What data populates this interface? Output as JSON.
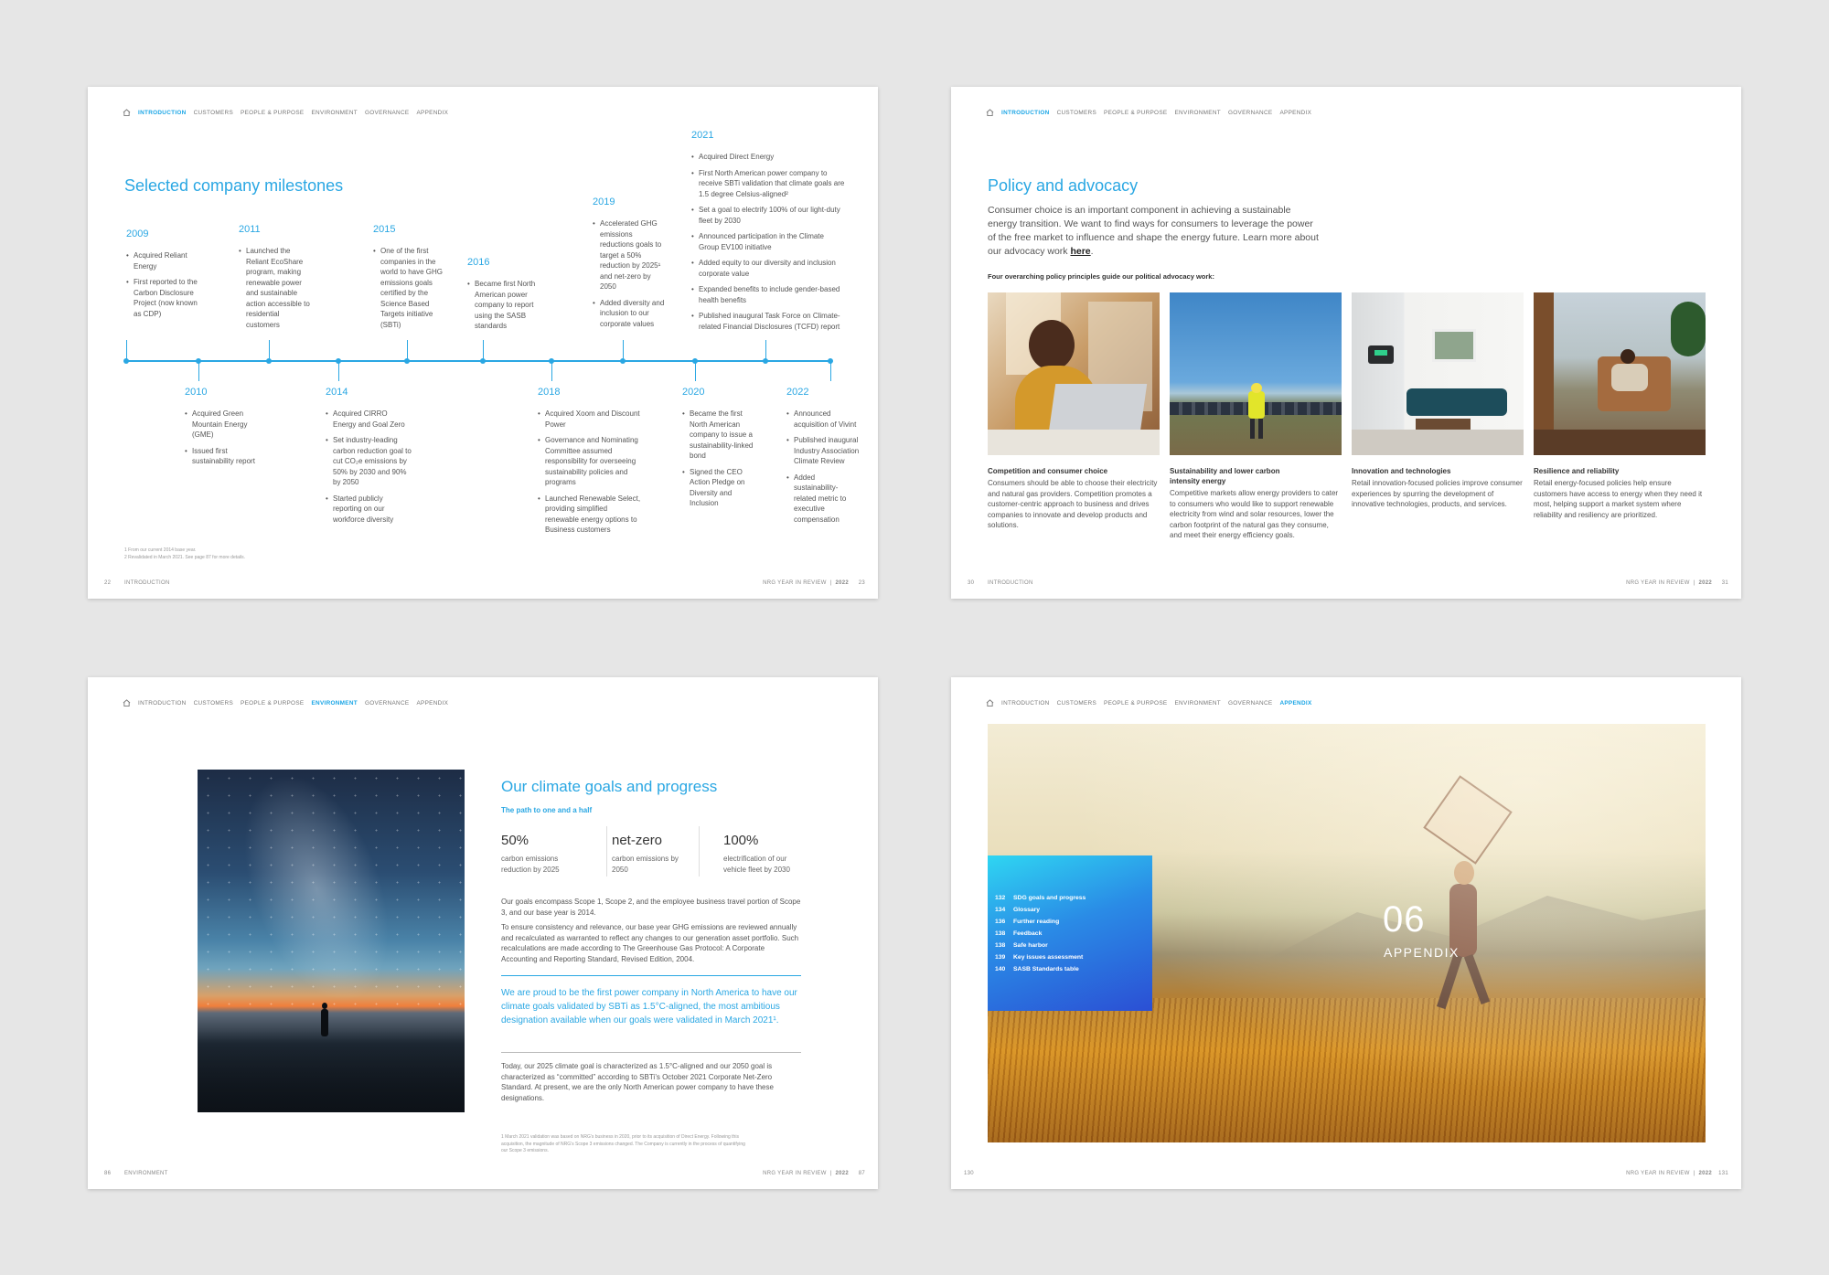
{
  "nav_items": [
    "INTRODUCTION",
    "CUSTOMERS",
    "PEOPLE & PURPOSE",
    "ENVIRONMENT",
    "GOVERNANCE",
    "APPENDIX"
  ],
  "brand_footer": "NRG YEAR IN REVIEW",
  "brand_year": "2022",
  "colors": {
    "accent": "#2aa7e3",
    "background": "#e6e6e6",
    "page": "#ffffff"
  },
  "spread1": {
    "active_nav": "INTRODUCTION",
    "title": "Selected company milestones",
    "milestones_top": [
      {
        "year": "2009",
        "items": [
          "Acquired Reliant Energy",
          "First reported to the Carbon Disclosure Project (now known as CDP)"
        ]
      },
      {
        "year": "2011",
        "items": [
          "Launched the Reliant EcoShare program, making renewable power and sustainable action accessible to residential customers"
        ]
      },
      {
        "year": "2015",
        "items": [
          "One of the first companies in the world to have GHG emissions goals certified by the Science Based Targets initiative (SBTi)"
        ]
      },
      {
        "year": "2016",
        "items": [
          "Became first North American power company to report using the SASB standards"
        ]
      },
      {
        "year": "2019",
        "items": [
          "Accelerated GHG emissions reductions goals to target a 50% reduction by 2025¹ and net-zero by 2050",
          "Added diversity and inclusion to our corporate values"
        ]
      },
      {
        "year": "2021",
        "items": [
          "Acquired Direct Energy",
          "First North American power company to receive SBTi validation that climate goals are 1.5 degree Celsius-aligned²",
          "Set a goal to electrify 100% of our light-duty fleet by 2030",
          "Announced participation in the Climate Group EV100 initiative",
          "Added equity to our diversity and inclusion corporate value",
          "Expanded benefits to include gender-based health benefits",
          "Published inaugural Task Force on Climate-related Financial Disclosures (TCFD) report"
        ]
      }
    ],
    "milestones_bottom": [
      {
        "year": "2010",
        "items": [
          "Acquired Green Mountain Energy (GME)",
          "Issued first sustainability report"
        ]
      },
      {
        "year": "2014",
        "items": [
          "Acquired CIRRO Energy and Goal Zero",
          "Set industry-leading carbon reduction goal to cut CO₂e emissions by 50% by 2030 and 90% by 2050",
          "Started publicly reporting on our workforce diversity"
        ]
      },
      {
        "year": "2018",
        "items": [
          "Acquired Xoom and Discount Power",
          "Governance and Nominating Committee assumed responsibility for overseeing sustainability policies and programs",
          "Launched Renewable Select, providing simplified renewable energy options to Business customers"
        ]
      },
      {
        "year": "2020",
        "items": [
          "Became the first North American company to issue a sustainability-linked bond",
          "Signed the CEO Action Pledge on Diversity and Inclusion"
        ]
      },
      {
        "year": "2022",
        "items": [
          "Announced acquisition of Vivint",
          "Published inaugural Industry Association Climate Review",
          "Added sustainability-related metric to executive compensation"
        ]
      }
    ],
    "footnotes": [
      "1   From our current 2014 base year.",
      "2   Revalidated in March 2021. See page 87 for more details."
    ],
    "page_left": "22",
    "section_label": "INTRODUCTION",
    "page_right": "23"
  },
  "spread2": {
    "active_nav": "INTRODUCTION",
    "title": "Policy and advocacy",
    "intro_text": "Consumer choice is an important component in achieving a sustainable energy transition. We want to find ways for consumers to leverage the power of the free market to influence and shape the energy future. Learn more about our advocacy work",
    "intro_link": "here",
    "subhead": "Four overarching policy principles guide our political advocacy work:",
    "cards": [
      {
        "title": "Competition and consumer choice",
        "body": "Consumers should be able to choose their electricity and natural gas providers. Competition promotes a customer-centric approach to business and drives companies to innovate and develop products and solutions."
      },
      {
        "title": "Sustainability and lower carbon intensity energy",
        "body": "Competitive markets allow energy providers to cater to consumers who would like to support renewable electricity from wind and solar resources, lower the carbon footprint of the natural gas they consume, and meet their energy efficiency goals."
      },
      {
        "title": "Innovation and technologies",
        "body": "Retail innovation-focused policies improve consumer experiences by spurring the development of innovative technologies, products, and services."
      },
      {
        "title": "Resilience and reliability",
        "body": "Retail energy-focused policies help ensure customers have access to energy when they need it most, helping support a market system where reliability and resiliency are prioritized."
      }
    ],
    "page_left": "30",
    "section_label": "INTRODUCTION",
    "page_right": "31"
  },
  "spread3": {
    "active_nav": "ENVIRONMENT",
    "title": "Our climate goals and progress",
    "subtitle": "The path to one and a half",
    "stats": [
      {
        "value": "50%",
        "label": "carbon emissions reduction by 2025"
      },
      {
        "value": "net-zero",
        "label": "carbon emissions by 2050"
      },
      {
        "value": "100%",
        "label": "electrification of our vehicle fleet by 2030"
      }
    ],
    "para1": "Our goals encompass Scope 1, Scope 2, and the employee business travel portion of Scope 3, and our base year is 2014.",
    "para2": "To ensure consistency and relevance, our base year GHG emissions are reviewed annually and recalculated as warranted to reflect any changes to our generation asset portfolio. Such recalculations are made according to The Greenhouse Gas Protocol: A Corporate Accounting and Reporting Standard, Revised Edition, 2004.",
    "callout": "We are proud to be the first power company in North America to have our climate goals validated by SBTi as 1.5°C-aligned, the most ambitious designation available when our goals were validated in March 2021¹.",
    "para3": "Today, our 2025 climate goal is characterized as 1.5°C-aligned and our 2050 goal is characterized as “committed” according to SBTi’s October 2021 Corporate Net-Zero Standard. At present, we are the only North American power company to have these designations.",
    "footnote": "1   March 2021 validation was based on NRG’s business in 2020, prior to its acquisition of Direct Energy. Following this acquisition, the magnitude of NRG’s Scope 3 emissions changed. The Company is currently in the process of quantifying our Scope 3 emissions.",
    "page_left": "86",
    "section_label": "ENVIRONMENT",
    "page_right": "87"
  },
  "spread4": {
    "active_nav": "APPENDIX",
    "toc": [
      {
        "page": "132",
        "label": "SDG goals and progress"
      },
      {
        "page": "134",
        "label": "Glossary"
      },
      {
        "page": "136",
        "label": "Further reading"
      },
      {
        "page": "138",
        "label": "Feedback"
      },
      {
        "page": "138",
        "label": "Safe harbor"
      },
      {
        "page": "139",
        "label": "Key issues assessment"
      },
      {
        "page": "140",
        "label": "SASB Standards table"
      }
    ],
    "chapter_number": "06",
    "chapter_title": "APPENDIX",
    "page_left": "130",
    "page_right": "131"
  }
}
